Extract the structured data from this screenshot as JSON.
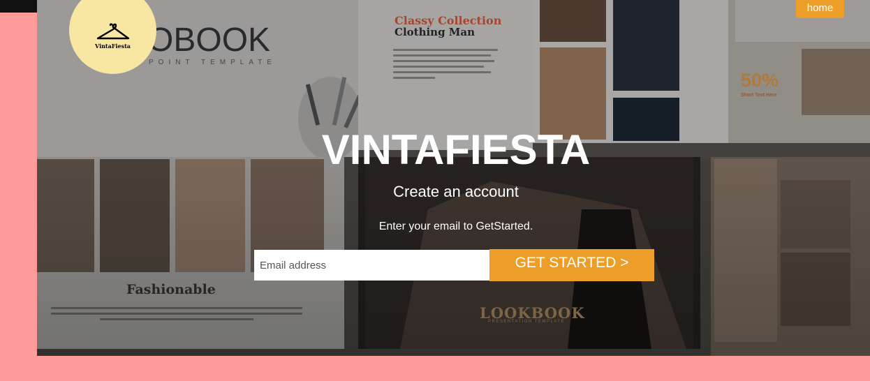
{
  "logo": {
    "name": "VintaFiesta"
  },
  "nav": {
    "home_label": "home"
  },
  "hero": {
    "title": "VINTAFIESTA",
    "subtitle": "Create an account",
    "cta_text": "Enter your email to GetStarted.",
    "email_placeholder": "Email address",
    "button_label": "GET STARTED >"
  },
  "background": {
    "lookbook_heading": "OBOOK",
    "lookbook_sub": "POINT TEMPLATE",
    "collection_title": "Classy Collection",
    "collection_subtitle": "Clothing Man",
    "discount": "50%",
    "discount_caption": "Short Text Here",
    "fashionable": "Fashionable",
    "lookbook_footer": "LOOKBOOK",
    "lookbook_footer_sub": "PRESENTATION TEMPLATE"
  },
  "colors": {
    "page_bg": "#FF9B98",
    "accent": "#ED9E28",
    "logo_bg": "#F8E7A2"
  }
}
